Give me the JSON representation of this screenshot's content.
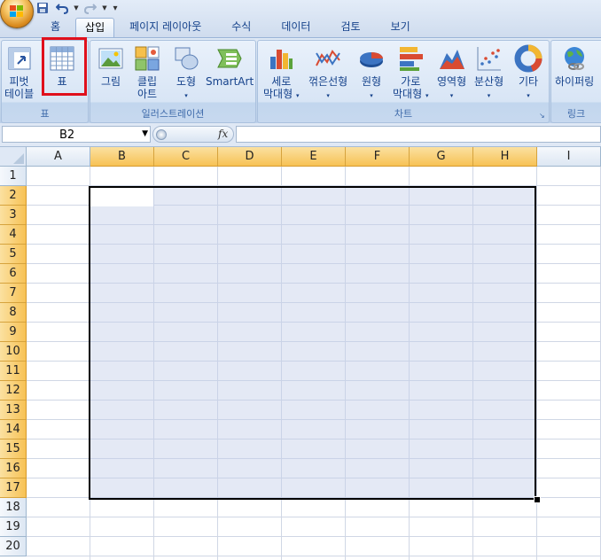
{
  "quick_access": {
    "save": "save-icon",
    "undo": "undo-icon",
    "redo": "redo-icon",
    "customize": "▾"
  },
  "tabs": [
    {
      "label": "홈"
    },
    {
      "label": "삽입",
      "active": true
    },
    {
      "label": "페이지 레이아웃"
    },
    {
      "label": "수식"
    },
    {
      "label": "데이터"
    },
    {
      "label": "검토"
    },
    {
      "label": "보기"
    }
  ],
  "ribbon": {
    "groups": {
      "table": "표",
      "illustrations": "일러스트레이션",
      "charts": "차트",
      "links": "링크"
    },
    "buttons": {
      "pivot_table": [
        "피벗",
        "테이블"
      ],
      "table": "표",
      "picture": "그림",
      "clipart": [
        "클립",
        "아트"
      ],
      "shapes": "도형",
      "smartart": "SmartArt",
      "column_chart": [
        "세로",
        "막대형"
      ],
      "line_chart": "꺾은선형",
      "pie_chart": "원형",
      "bar_chart": [
        "가로",
        "막대형"
      ],
      "area_chart": "영역형",
      "scatter_chart": "분산형",
      "other_charts": "기타",
      "hyperlink": "하이퍼링"
    }
  },
  "formula_bar": {
    "name_box": "B2",
    "fx": "fx",
    "formula": ""
  },
  "sheet": {
    "columns": [
      "A",
      "B",
      "C",
      "D",
      "E",
      "F",
      "G",
      "H",
      "I"
    ],
    "rows": [
      "1",
      "2",
      "3",
      "4",
      "5",
      "6",
      "7",
      "8",
      "9",
      "10",
      "11",
      "12",
      "13",
      "14",
      "15",
      "16",
      "17",
      "18",
      "19",
      "20"
    ],
    "selected_columns": [
      "B",
      "C",
      "D",
      "E",
      "F",
      "G",
      "H"
    ],
    "selected_rows": [
      "2",
      "3",
      "4",
      "5",
      "6",
      "7",
      "8",
      "9",
      "10",
      "11",
      "12",
      "13",
      "14",
      "15",
      "16",
      "17"
    ],
    "active_cell": "B2",
    "selection_range": "B2:H17"
  },
  "colors": {
    "header_selected": "#f7c255",
    "selection_fill": "#c4cee8",
    "highlight_box": "#e0101c"
  }
}
